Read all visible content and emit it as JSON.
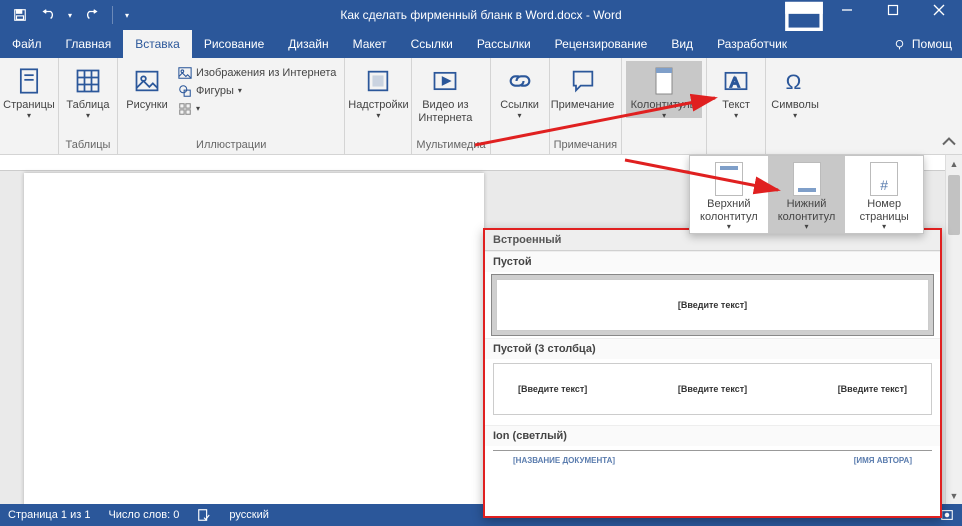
{
  "title": "Как сделать фирменный бланк в Word.docx  -  Word",
  "tabs": {
    "file": "Файл",
    "home": "Главная",
    "insert": "Вставка",
    "draw": "Рисование",
    "design": "Дизайн",
    "layout": "Макет",
    "refs": "Ссылки",
    "mail": "Рассылки",
    "review": "Рецензирование",
    "view": "Вид",
    "dev": "Разработчик",
    "tellme": "Помощ"
  },
  "ribbon": {
    "pages": {
      "label": "Страницы",
      "group": ""
    },
    "tables": {
      "label": "Таблица",
      "group": "Таблицы"
    },
    "pictures": "Рисунки",
    "online_pics": "Изображения из Интернета",
    "shapes": "Фигуры",
    "illustr_group": "Иллюстрации",
    "addins": "Надстройки",
    "video": "Видео из Интернета",
    "media_group": "Мультимедиа",
    "links": "Ссылки",
    "comment": "Примечание",
    "comments_group": "Примечания",
    "headerfooter": "Колонтитулы",
    "text": "Текст",
    "symbols": "Символы"
  },
  "flyout": {
    "header": "Верхний колонтитул",
    "footer": "Нижний колонтитул",
    "pagenum": "Номер страницы"
  },
  "gallery": {
    "builtin": "Встроенный",
    "blank": "Пустой",
    "blank3": "Пустой (3 столбца)",
    "ion": "Ion (светлый)",
    "placeholder": "[Введите текст]",
    "ion_left": "[НАЗВАНИЕ ДОКУМЕНТА]",
    "ion_right": "[ИМЯ АВТОРА]"
  },
  "status": {
    "page": "Страница 1 из 1",
    "words": "Число слов: 0",
    "lang": "русский"
  }
}
